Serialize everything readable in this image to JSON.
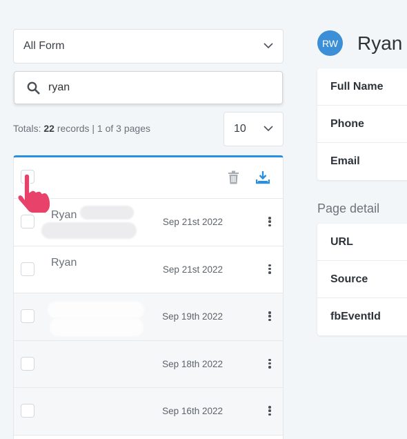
{
  "filter": {
    "selected": "All Form"
  },
  "search": {
    "value": "ryan"
  },
  "totals": {
    "prefix": "Totals:",
    "count": "22",
    "suffix": "records | 1 of 3 pages"
  },
  "per_page": {
    "selected": "10"
  },
  "records": [
    {
      "name": "Ryan",
      "date": "Sep 21st 2022"
    },
    {
      "name": "Ryan",
      "date": "Sep 21st 2022"
    },
    {
      "name": "",
      "date": "Sep 19th 2022"
    },
    {
      "name": "",
      "date": "Sep 18th 2022"
    },
    {
      "name": "",
      "date": "Sep 16th 2022"
    }
  ],
  "profile": {
    "initials": "RW",
    "name": "Ryan"
  },
  "contact_fields": [
    "Full Name",
    "Phone",
    "Email"
  ],
  "page_detail": {
    "title": "Page detail",
    "fields": [
      "URL",
      "Source",
      "fbEventId"
    ]
  },
  "colors": {
    "accent": "#2b8fe0",
    "avatar": "#3a8fd6",
    "pointer": "#e8426a"
  }
}
